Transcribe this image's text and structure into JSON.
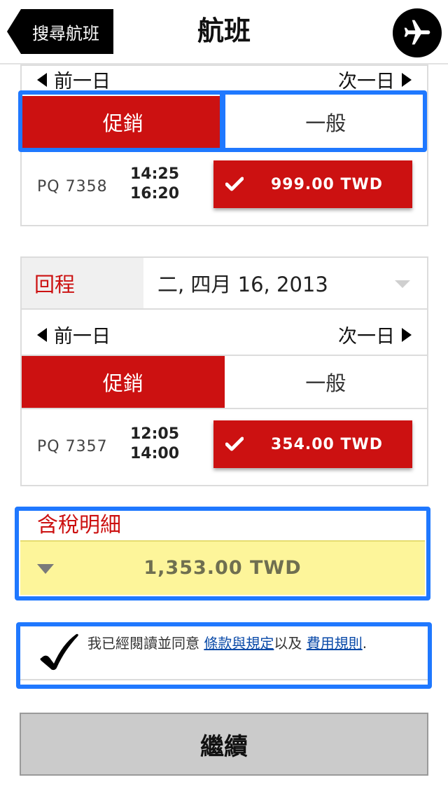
{
  "header": {
    "back_label": "搜尋航班",
    "title": "航班",
    "plane_icon": "airplane-icon"
  },
  "outbound": {
    "prev_day": "前一日",
    "next_day": "次一日",
    "tab_promo": "促銷",
    "tab_regular": "一般",
    "active_tab": "促銷",
    "flight_no": "PQ 7358",
    "depart": "14:25",
    "arrive": "16:20",
    "price": "999.00 TWD"
  },
  "return": {
    "label": "回程",
    "date": "二, 四月 16, 2013",
    "prev_day": "前一日",
    "next_day": "次一日",
    "tab_promo": "促銷",
    "tab_regular": "一般",
    "active_tab": "促銷",
    "flight_no": "PQ 7357",
    "depart": "12:05",
    "arrive": "14:00",
    "price": "354.00 TWD"
  },
  "tax": {
    "label": "含稅明細",
    "total": "1,353.00 TWD"
  },
  "terms": {
    "text_prefix": "我已經閱讀並同意 ",
    "link1": "條款與規定",
    "text_mid": "以及 ",
    "link2": "費用規則",
    "text_suffix": "."
  },
  "continue_label": "繼續",
  "colors": {
    "accent_red": "#cc1111",
    "highlight_blue": "#1f78ff",
    "total_bg": "#fdf59a"
  }
}
